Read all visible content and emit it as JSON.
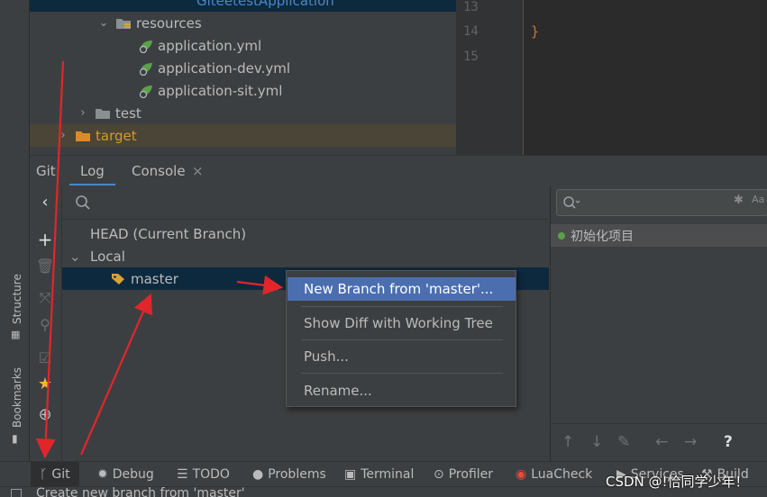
{
  "project_tree": {
    "top_partial": "GiteetestApplication",
    "resources": "resources",
    "files": [
      "application.yml",
      "application-dev.yml",
      "application-sit.yml"
    ],
    "test": "test",
    "target": "target"
  },
  "editor": {
    "line_numbers": [
      "13",
      "14",
      "15"
    ],
    "brace": "}"
  },
  "git_window": {
    "label": "Git:",
    "tabs": [
      "Log",
      "Console"
    ],
    "close_glyph": "×"
  },
  "branches": {
    "head": "HEAD (Current Branch)",
    "local": "Local",
    "master": "master"
  },
  "commits": {
    "first_commit": "初始化项目"
  },
  "context_menu": {
    "items": [
      "New Branch from 'master'...",
      "Show Diff with Working Tree",
      "Push...",
      "Rename..."
    ]
  },
  "side_labels": {
    "structure": "Structure",
    "bookmarks": "Bookmarks"
  },
  "bottom_bar": {
    "items": [
      "Git",
      "Debug",
      "TODO",
      "Problems",
      "Terminal",
      "Profiler",
      "LuaCheck",
      "Services",
      "Build"
    ]
  },
  "status": {
    "message": "Create new branch from 'master'"
  },
  "watermark": "CSDN @!恰同学少年！",
  "colors": {
    "selection": "#0d293e",
    "menu_highlight": "#4b6eaf",
    "accent_tab": "#4a88c7",
    "annotation_arrow": "#e0262b",
    "yml_green": "#5aa14a",
    "folder_orange": "#d19a2e"
  }
}
